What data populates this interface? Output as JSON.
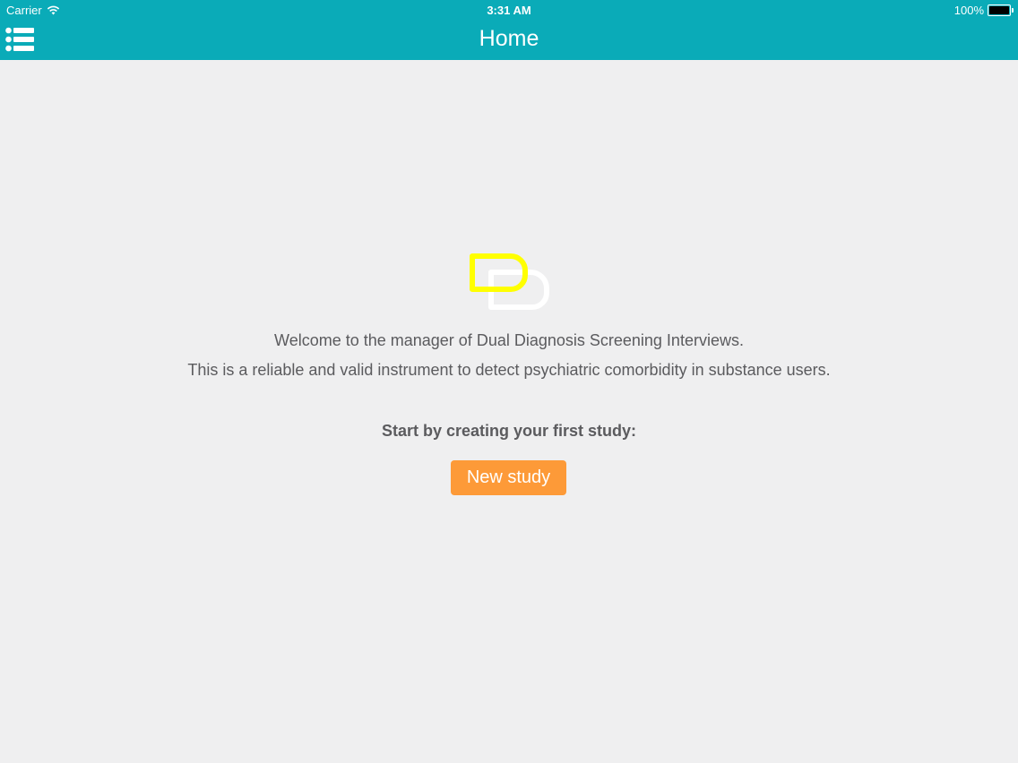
{
  "status_bar": {
    "carrier": "Carrier",
    "time": "3:31 AM",
    "battery": "100%"
  },
  "nav": {
    "title": "Home",
    "menu_icon": "list-icon"
  },
  "welcome": {
    "line1": "Welcome to the manager of Dual Diagnosis Screening Interviews.",
    "line2": "This is a reliable and valid instrument to detect psychiatric comorbidity in substance users."
  },
  "cta": {
    "heading": "Start by creating your first study:",
    "button_label": "New study"
  },
  "colors": {
    "topbar": "#0aabb8",
    "background": "#efeff0",
    "button": "#fd9a38",
    "logo_yellow": "#ffff00",
    "text": "#5b5b5e"
  }
}
